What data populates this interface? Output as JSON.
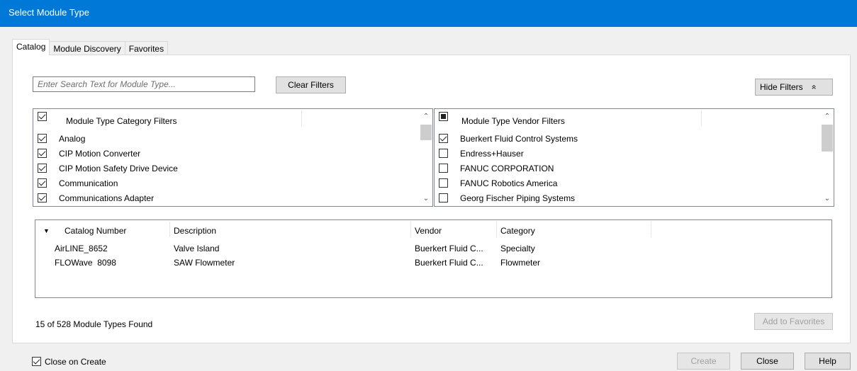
{
  "window": {
    "title": "Select Module Type"
  },
  "tabs": [
    {
      "label": "Catalog",
      "active": true
    },
    {
      "label": "Module Discovery",
      "active": false
    },
    {
      "label": "Favorites",
      "active": false
    }
  ],
  "search": {
    "placeholder": "Enter Search Text for Module Type..."
  },
  "buttons": {
    "clear_filters": "Clear Filters",
    "hide_filters": "Hide Filters",
    "hide_filters_glyph": "»",
    "add_to_favorites": "Add to Favorites",
    "create": "Create",
    "close": "Close",
    "help": "Help"
  },
  "category_filters": {
    "header": "Module Type Category Filters",
    "header_checked": true,
    "items": [
      {
        "label": "Analog",
        "checked": true
      },
      {
        "label": "CIP Motion Converter",
        "checked": true
      },
      {
        "label": "CIP Motion Safety Drive Device",
        "checked": true
      },
      {
        "label": "Communication",
        "checked": true
      },
      {
        "label": "Communications Adapter",
        "checked": true
      }
    ]
  },
  "vendor_filters": {
    "header": "Module Type Vendor Filters",
    "header_state": "partial",
    "items": [
      {
        "label": "Buerkert Fluid Control Systems",
        "checked": true
      },
      {
        "label": "Endress+Hauser",
        "checked": false
      },
      {
        "label": "FANUC CORPORATION",
        "checked": false
      },
      {
        "label": "FANUC Robotics America",
        "checked": false
      },
      {
        "label": "Georg Fischer Piping Systems",
        "checked": false
      }
    ]
  },
  "results": {
    "sort_glyph": "▼",
    "columns": [
      "Catalog Number",
      "Description",
      "Vendor",
      "Category"
    ],
    "rows": [
      [
        "AirLINE_8652",
        "Valve Island",
        "Buerkert Fluid C...",
        "Specialty"
      ],
      [
        "FLOWave  8098",
        "SAW Flowmeter",
        "Buerkert Fluid C...",
        "Flowmeter"
      ]
    ]
  },
  "status": "15 of 528 Module Types Found",
  "close_on_create": {
    "label": "Close on Create",
    "checked": true
  },
  "colors": {
    "titlebar": "#0078d7",
    "dialog_bg": "#f0f0f0"
  }
}
